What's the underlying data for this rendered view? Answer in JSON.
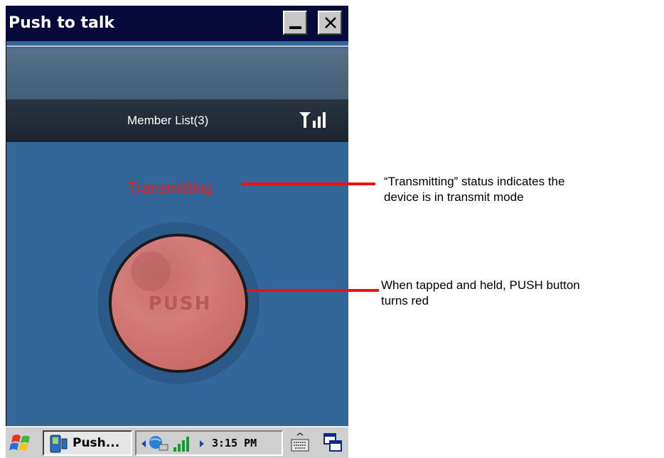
{
  "window": {
    "title": "Push to talk",
    "minimize_icon": "minimize-icon",
    "close_icon": "close-icon"
  },
  "app": {
    "member_list": "Member List(3)",
    "signal_icon": "signal-strength-icon",
    "status": "Transmitting",
    "push_label": "PUSH",
    "colors": {
      "status": "#ee1c1c",
      "push_button": "#d47a78",
      "background": "#346799"
    }
  },
  "taskbar": {
    "start_icon": "windows-start-icon",
    "task_label": "Push...",
    "time": "3:15 PM",
    "keyboard_icon": "keyboard-icon",
    "windows_icon": "switch-window-icon"
  },
  "callouts": [
    {
      "text_line1": "“Transmitting” status indicates the",
      "text_line2": "device is in transmit mode"
    },
    {
      "text_line1": "When tapped and held, PUSH button",
      "text_line2": "turns red"
    }
  ]
}
